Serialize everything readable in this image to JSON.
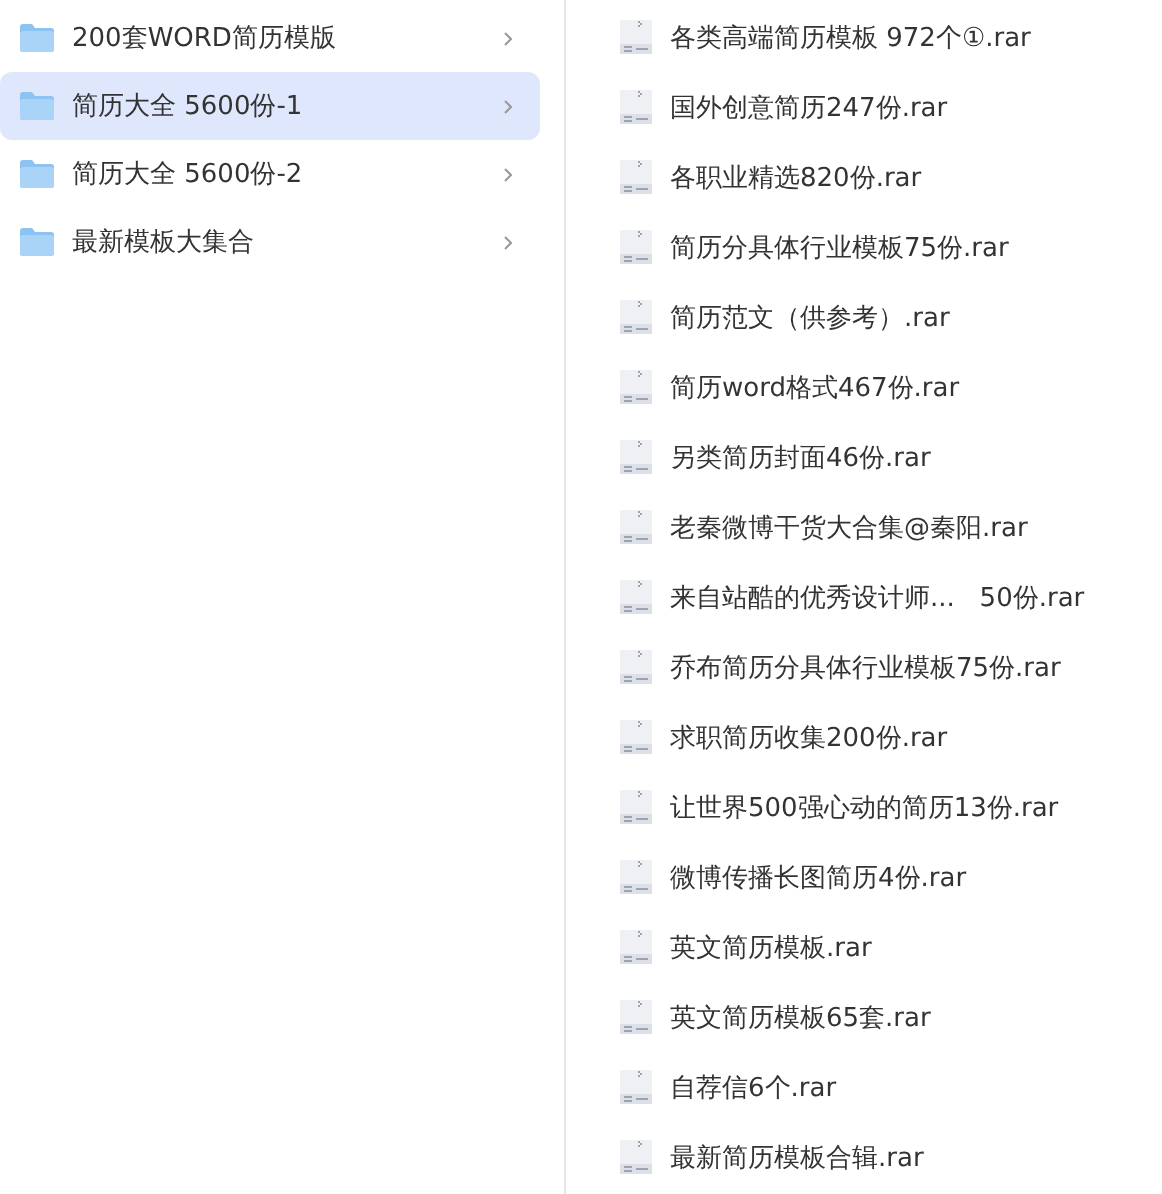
{
  "folders": [
    {
      "name": "200套WORD简历模版",
      "selected": false
    },
    {
      "name": "简历大全 5600份-1",
      "selected": true
    },
    {
      "name": "简历大全 5600份-2",
      "selected": false
    },
    {
      "name": "最新模板大集合",
      "selected": false
    }
  ],
  "files": [
    {
      "name": "各类高端简历模板 972个①.rar"
    },
    {
      "name": "国外创意简历247份.rar"
    },
    {
      "name": "各职业精选820份.rar"
    },
    {
      "name": "简历分具体行业模板75份.rar"
    },
    {
      "name": "简历范文（供参考）.rar"
    },
    {
      "name": "简历word格式467份.rar"
    },
    {
      "name": "另类简历封面46份.rar"
    },
    {
      "name": "老秦微博干货大合集@秦阳.rar"
    },
    {
      "name": "来自站酷的优秀设计师...   50份.rar"
    },
    {
      "name": "乔布简历分具体行业模板75份.rar"
    },
    {
      "name": "求职简历收集200份.rar"
    },
    {
      "name": "让世界500强心动的简历13份.rar"
    },
    {
      "name": "微博传播长图简历4份.rar"
    },
    {
      "name": "英文简历模板.rar"
    },
    {
      "name": "英文简历模板65套.rar"
    },
    {
      "name": "自荐信6个.rar"
    },
    {
      "name": "最新简历模板合辑.rar"
    }
  ]
}
